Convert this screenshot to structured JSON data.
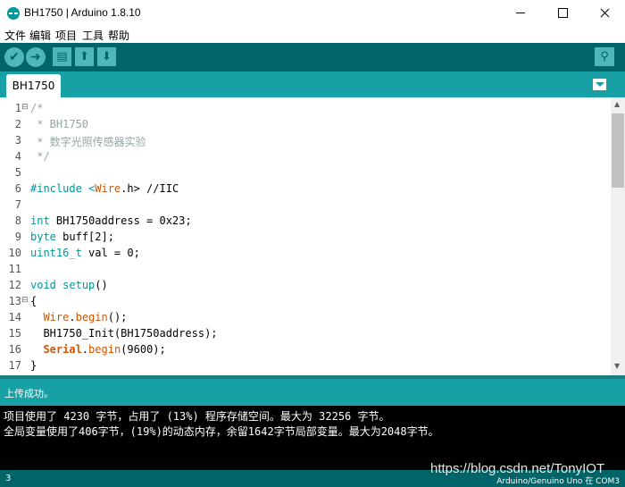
{
  "window": {
    "title": "BH1750 | Arduino 1.8.10"
  },
  "menu": [
    "文件",
    "编辑",
    "项目",
    "工具",
    "帮助"
  ],
  "toolbar": {
    "verify_icon": "check-icon",
    "upload_icon": "arrow-right-icon",
    "new_icon": "document-icon",
    "open_icon": "arrow-up-icon",
    "save_icon": "arrow-down-icon",
    "serial_icon": "magnifier-icon"
  },
  "tab": {
    "label": "BH1750"
  },
  "code": {
    "line_numbers": [
      "1",
      "2",
      "3",
      "4",
      "5",
      "6",
      "7",
      "8",
      "9",
      "10",
      "11",
      "12",
      "13",
      "14",
      "15",
      "16",
      "17"
    ],
    "l1": "/*",
    "l2": " * BH1750",
    "l3": " * 数字光照传感器实验",
    "l4": " */",
    "l6a": "#include <",
    "l6b": "Wire",
    "l6c": ".h> //IIC",
    "l8a": "int",
    "l8b": " BH1750address = 0x23;",
    "l9a": "byte",
    "l9b": " buff[2];",
    "l10a": "uint16_t",
    "l10b": " val = 0;",
    "l12a": "void",
    "l12b": " ",
    "l12c": "setup",
    "l12d": "()",
    "l13": "{",
    "l14a": "  ",
    "l14b": "Wire",
    "l14c": ".",
    "l14d": "begin",
    "l14e": "();",
    "l15": "  BH1750_Init(BH1750address);",
    "l16a": "  ",
    "l16b": "Serial",
    "l16c": ".",
    "l16d": "begin",
    "l16e": "(9600);",
    "l17": "}"
  },
  "status": {
    "message": "上传成功。"
  },
  "console": [
    "项目使用了 4230 字节，占用了 (13%) 程序存储空间。最大为 32256 字节。",
    "全局变量使用了406字节，(19%)的动态内存，余留1642字节局部变量。最大为2048字节。"
  ],
  "footer": {
    "line": "3",
    "board": "Arduino/Genuino Uno 在 COM3"
  },
  "watermark": "https://blog.csdn.net/TonyIOT",
  "colors": {
    "toolbar": "#006468",
    "tabbar": "#17a1a5",
    "keyword": "#00979c",
    "function": "#d35400",
    "comment": "#95a5a6"
  }
}
